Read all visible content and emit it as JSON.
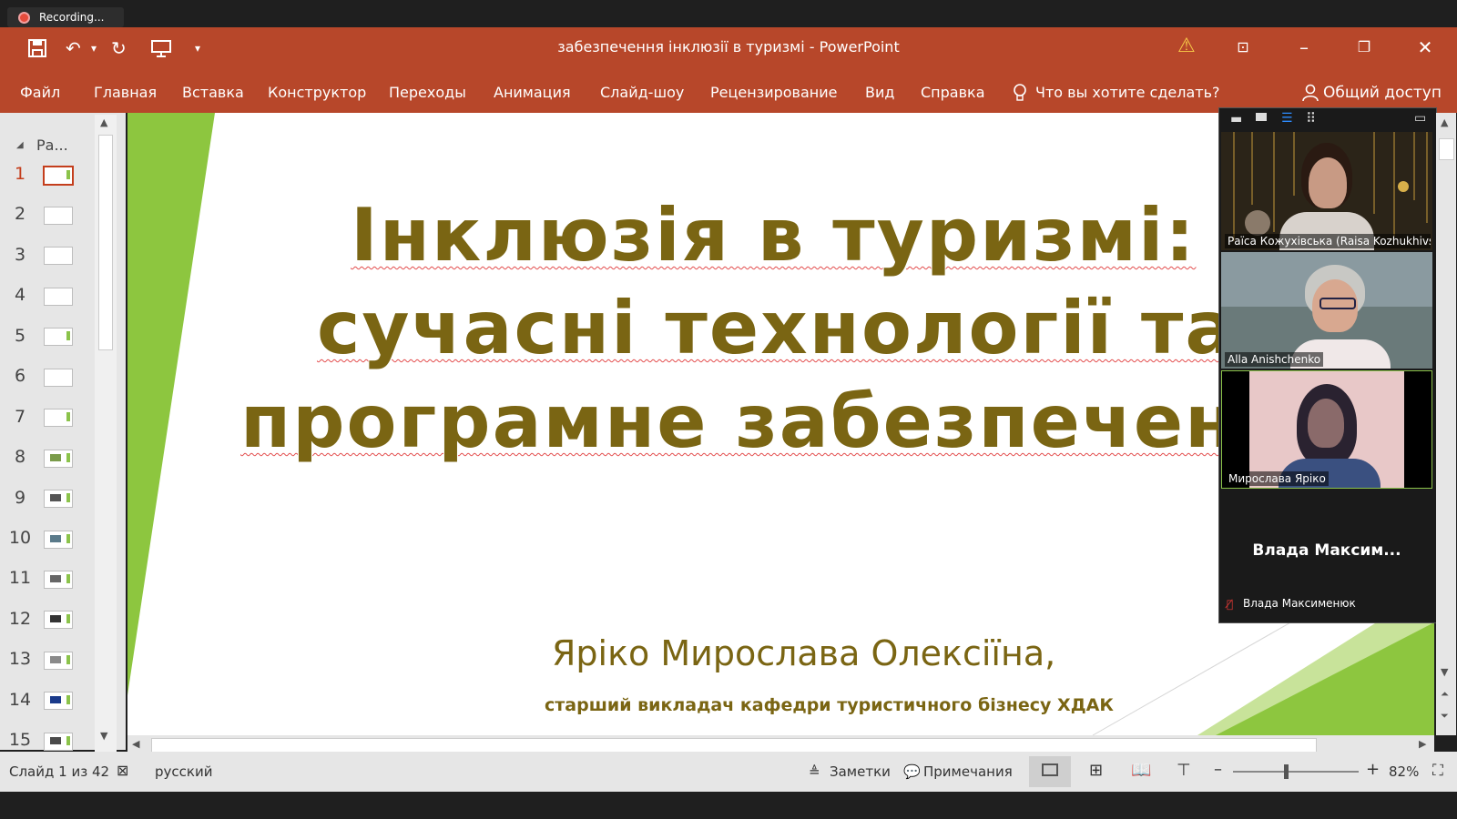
{
  "recording": {
    "label": "Recording..."
  },
  "window": {
    "title": "забезпечення інклюзії в туризмі  -  PowerPoint"
  },
  "ribbon": {
    "tabs": [
      "Файл",
      "Главная",
      "Вставка",
      "Конструктор",
      "Переходы",
      "Анимация",
      "Слайд-шоу",
      "Рецензирование",
      "Вид",
      "Справка"
    ],
    "search": "Что вы хотите сделать?",
    "share": "Общий доступ"
  },
  "thumbnails": {
    "section": "Ра...",
    "numbers": [
      "1",
      "2",
      "3",
      "4",
      "5",
      "6",
      "7",
      "8",
      "9",
      "10",
      "11",
      "12",
      "13",
      "14",
      "15"
    ]
  },
  "slide": {
    "title_line1": "Інклюзія в туризмі:",
    "title_line2": "сучасні технології та",
    "title_line3": "програмне забезпечення",
    "author": "Яріко Мирослава Олексіїна,",
    "position": "старший викладач кафедри туристичного бізнесу ХДАК"
  },
  "status": {
    "slide_counter": "Слайд 1 из 42",
    "language": "русский",
    "notes": "Заметки",
    "comments": "Примечания",
    "zoom": "82%"
  },
  "participants": [
    {
      "name": "Раїса Кожухівська (Raisa Kozhukhivs..."
    },
    {
      "name": "Alla Anishchenko"
    },
    {
      "name": "Мирослава Яріко"
    },
    {
      "display": "Влада  Максим...",
      "name": "Влада Максименюк"
    }
  ]
}
